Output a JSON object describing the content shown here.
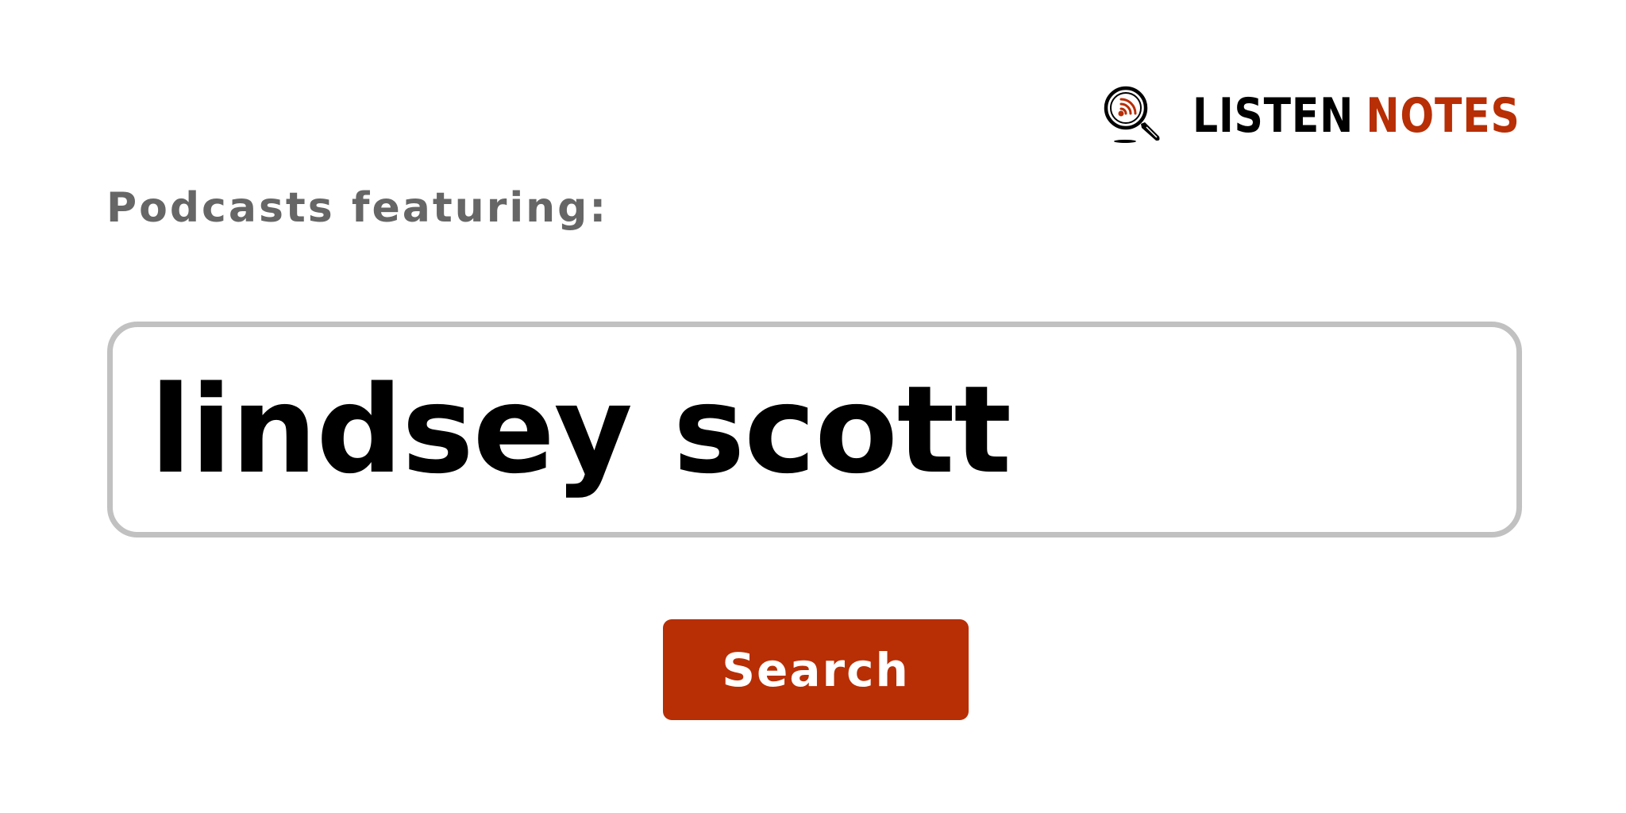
{
  "logo": {
    "word_primary": "LISTEN",
    "word_accent": "NOTES",
    "icon": "magnifier-podcast-icon",
    "primary_color": "#000000",
    "accent_color": "#b82e05"
  },
  "label": {
    "text": "Podcasts featuring:"
  },
  "search": {
    "value": "lindsey scott",
    "button_label": "Search",
    "button_color": "#b82e05",
    "border_color": "#c1c1c1"
  }
}
